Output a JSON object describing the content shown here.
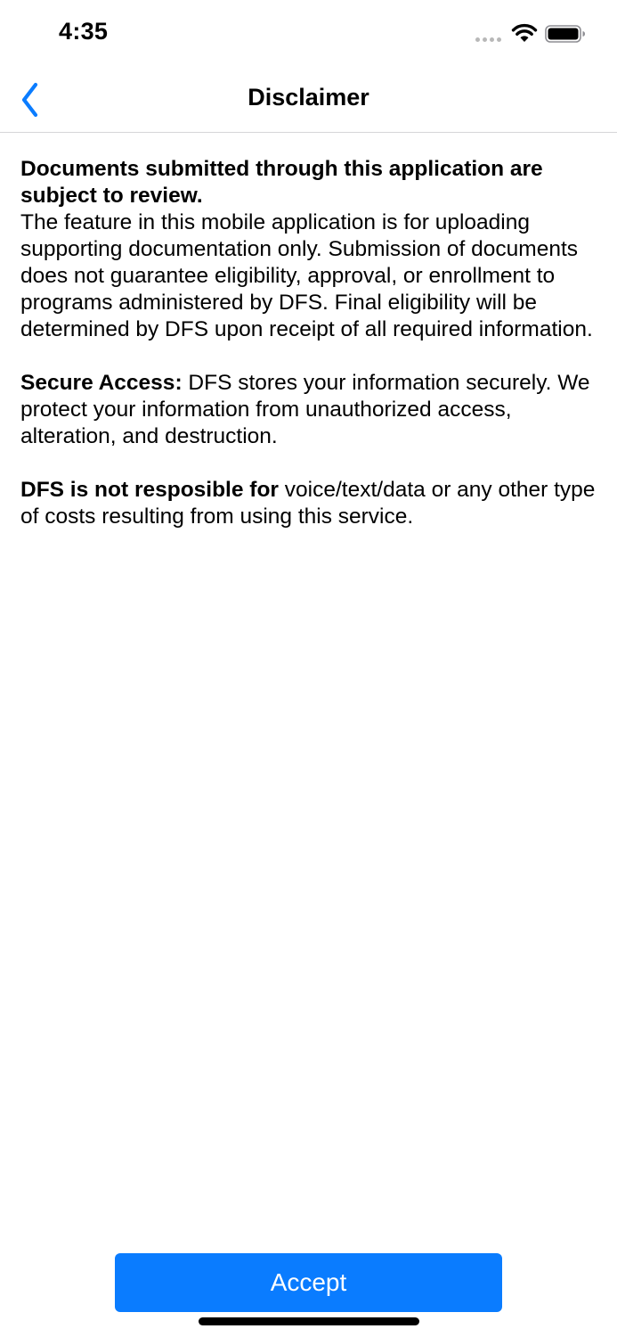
{
  "status_bar": {
    "time": "4:35"
  },
  "nav": {
    "back_icon": "chevron-left-icon",
    "title": "Disclaimer"
  },
  "content": {
    "p1_heading": "Documents submitted through this application are subject to review.",
    "p1_body": "The feature in this mobile application is for uploading supporting documentation only. Submission of documents does not guarantee eligibility, approval, or enrollment to programs administered by DFS. Final eligibility will be determined by DFS upon receipt of all required information.",
    "p2_bold": "Secure Access:",
    "p2_body": " DFS stores your information securely. We protect your information from unauthorized access, alteration, and destruction.",
    "p3_bold": "DFS is not resposible for",
    "p3_body": " voice/text/data or any other type of costs resulting from using this service."
  },
  "actions": {
    "accept_label": "Accept"
  },
  "colors": {
    "accent": "#0a7cff",
    "divider": "#d6d6d8"
  }
}
